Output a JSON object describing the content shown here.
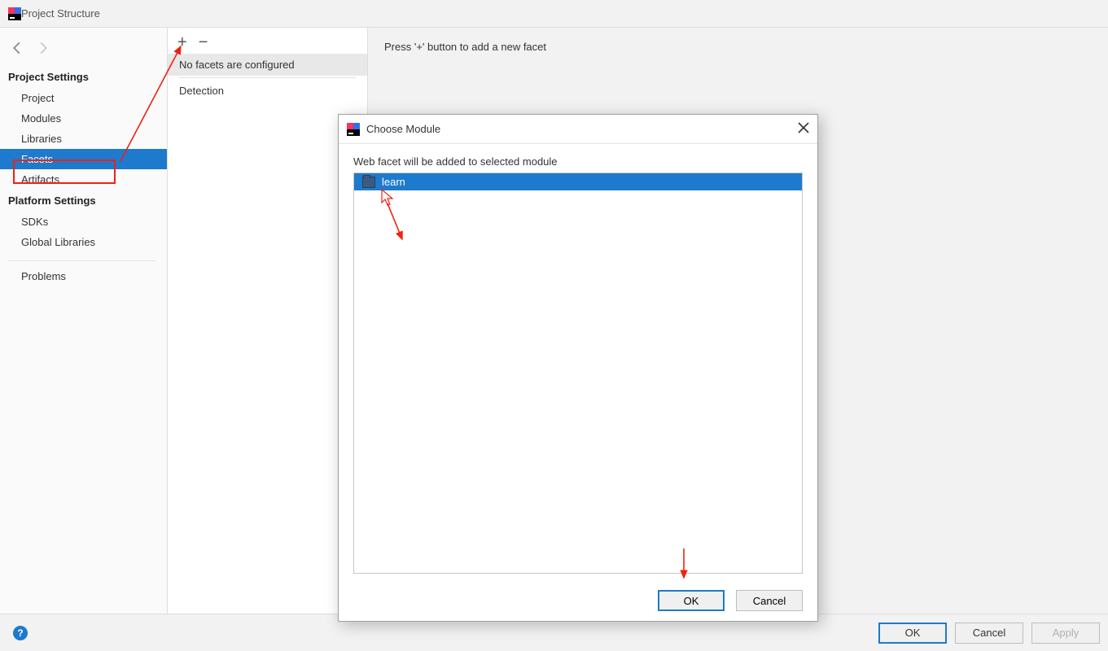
{
  "window": {
    "title": "Project Structure"
  },
  "sidebar": {
    "sections": {
      "project": {
        "title": "Project Settings",
        "items": [
          "Project",
          "Modules",
          "Libraries",
          "Facets",
          "Artifacts"
        ],
        "selected_index": 3
      },
      "platform": {
        "title": "Platform Settings",
        "items": [
          "SDKs",
          "Global Libraries"
        ]
      },
      "problems": {
        "label": "Problems"
      }
    }
  },
  "mid": {
    "add_tooltip": "+",
    "remove_tooltip": "−",
    "items": [
      "No facets are configured",
      "Detection"
    ],
    "selected_index": 0
  },
  "content": {
    "hint": "Press '+' button to add a new facet"
  },
  "dialog": {
    "title": "Choose Module",
    "instruction": "Web facet will be added to selected module",
    "modules": [
      "learn"
    ],
    "ok": "OK",
    "cancel": "Cancel"
  },
  "footer": {
    "ok": "OK",
    "cancel": "Cancel",
    "apply": "Apply"
  }
}
